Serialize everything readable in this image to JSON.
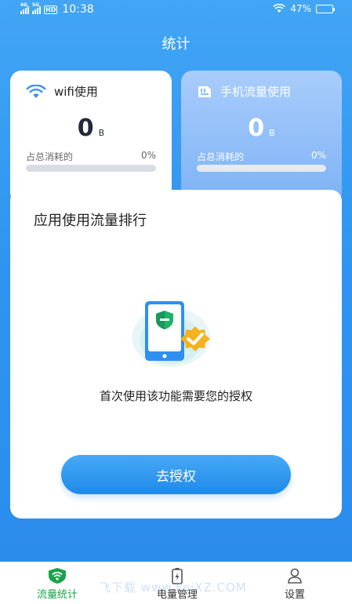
{
  "status_bar": {
    "sim1_type": "4G",
    "sim2_type": "5G",
    "hd_badge": "HD",
    "time": "10:38",
    "battery_percent": "47%",
    "battery_level": 0.47
  },
  "header": {
    "title": "统计"
  },
  "wifi_card": {
    "title": "wifi使用",
    "value": "0",
    "unit": "B",
    "share_label": "占总消耗的",
    "share_value": "0%",
    "share_fraction": 0
  },
  "mobile_card": {
    "title": "手机流量使用",
    "value": "0",
    "unit": "B",
    "share_label": "占总消耗的",
    "share_value": "0%",
    "share_fraction": 0
  },
  "ranking": {
    "title": "应用使用流量排行",
    "auth_message": "首次使用该功能需要您的授权",
    "auth_button": "去授权"
  },
  "tabbar": {
    "items": [
      {
        "label": "流量统计",
        "icon": "wifi-shield-icon",
        "active": true
      },
      {
        "label": "电量管理",
        "icon": "battery-icon",
        "active": false
      },
      {
        "label": "设置",
        "icon": "person-icon",
        "active": false
      }
    ]
  },
  "watermark": "飞下载 www.FeiXZ.COM",
  "colors": {
    "accent": "#2f95ef",
    "active_tab": "#1aa34a",
    "badge": "#f4b21e"
  }
}
